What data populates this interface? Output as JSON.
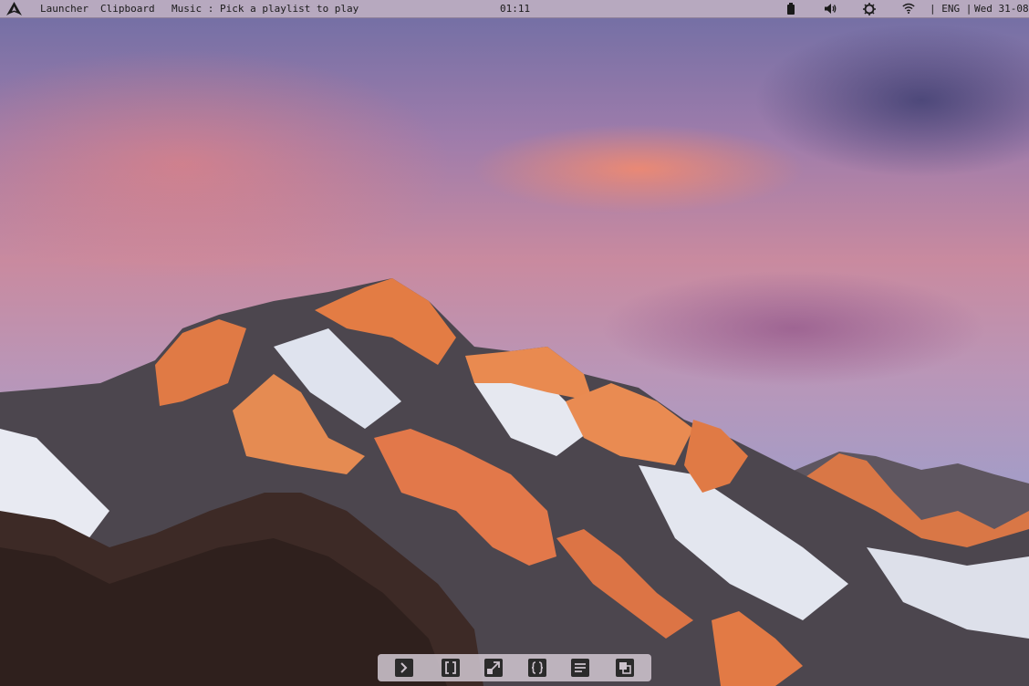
{
  "topbar": {
    "launcher_label": "Launcher",
    "clipboard_label": "Clipboard",
    "music_label": "Music : Pick a playlist to play",
    "clock": "01:11",
    "language": "| ENG |",
    "date": "Wed 31-08"
  },
  "icons": {
    "logo": "arch-logo-icon",
    "battery": "battery-icon",
    "volume": "volume-icon",
    "brightness": "brightness-icon",
    "wifi": "wifi-icon"
  },
  "dock": {
    "items": [
      "terminal-icon",
      "brackets-icon",
      "resize-icon",
      "braces-icon",
      "document-icon",
      "windows-icon"
    ]
  },
  "colors": {
    "topbar_bg": "#b7a9bf",
    "topbar_text": "#1a1a1a",
    "dock_bg": "#cdc3cd",
    "dock_icon": "#2b2b2b"
  }
}
